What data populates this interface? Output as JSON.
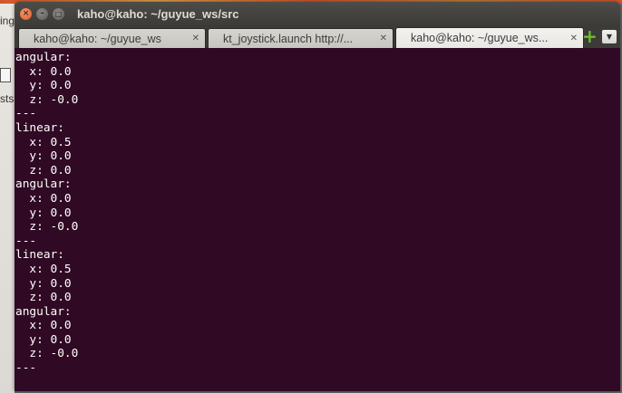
{
  "desktop": {
    "left_fragments": [
      "ing",
      "sts"
    ]
  },
  "window": {
    "title": "kaho@kaho: ~/guyue_ws/src",
    "close_glyph": "×",
    "min_glyph": "–",
    "max_glyph": "□"
  },
  "tabs": [
    {
      "label": "kaho@kaho: ~/guyue_ws",
      "close": "✕"
    },
    {
      "label": "kt_joystick.launch http://...",
      "close": "✕"
    },
    {
      "label": "kaho@kaho: ~/guyue_ws...",
      "close": "✕"
    }
  ],
  "tab_actions": {
    "add_glyph": "+",
    "menu_glyph": "▼"
  },
  "terminal": {
    "lines": [
      "angular:",
      "  x: 0.0",
      "  y: 0.0",
      "  z: -0.0",
      "---",
      "linear:",
      "  x: 0.5",
      "  y: 0.0",
      "  z: 0.0",
      "angular:",
      "  x: 0.0",
      "  y: 0.0",
      "  z: -0.0",
      "---",
      "linear:",
      "  x: 0.5",
      "  y: 0.0",
      "  z: 0.0",
      "angular:",
      "  x: 0.0",
      "  y: 0.0",
      "  z: -0.0",
      "---"
    ]
  },
  "colors": {
    "terminal_bg": "#300a24",
    "terminal_fg": "#ffffff",
    "titlebar": "#3c3b37",
    "close_button": "#e0552b",
    "add_tab_icon": "#6bbf2a"
  }
}
